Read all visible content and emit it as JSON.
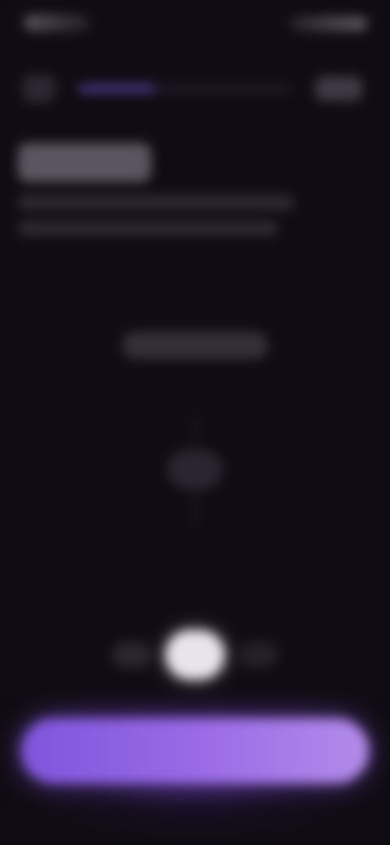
{
  "colors": {
    "background": "#100c13",
    "accent": "#9a6ae6",
    "progress_fill": "#4b3a8a",
    "selected_option": "#e8e4ec"
  },
  "header": {
    "progress_fraction": 0.36
  },
  "icons": {
    "back": "chevron-left-icon"
  }
}
